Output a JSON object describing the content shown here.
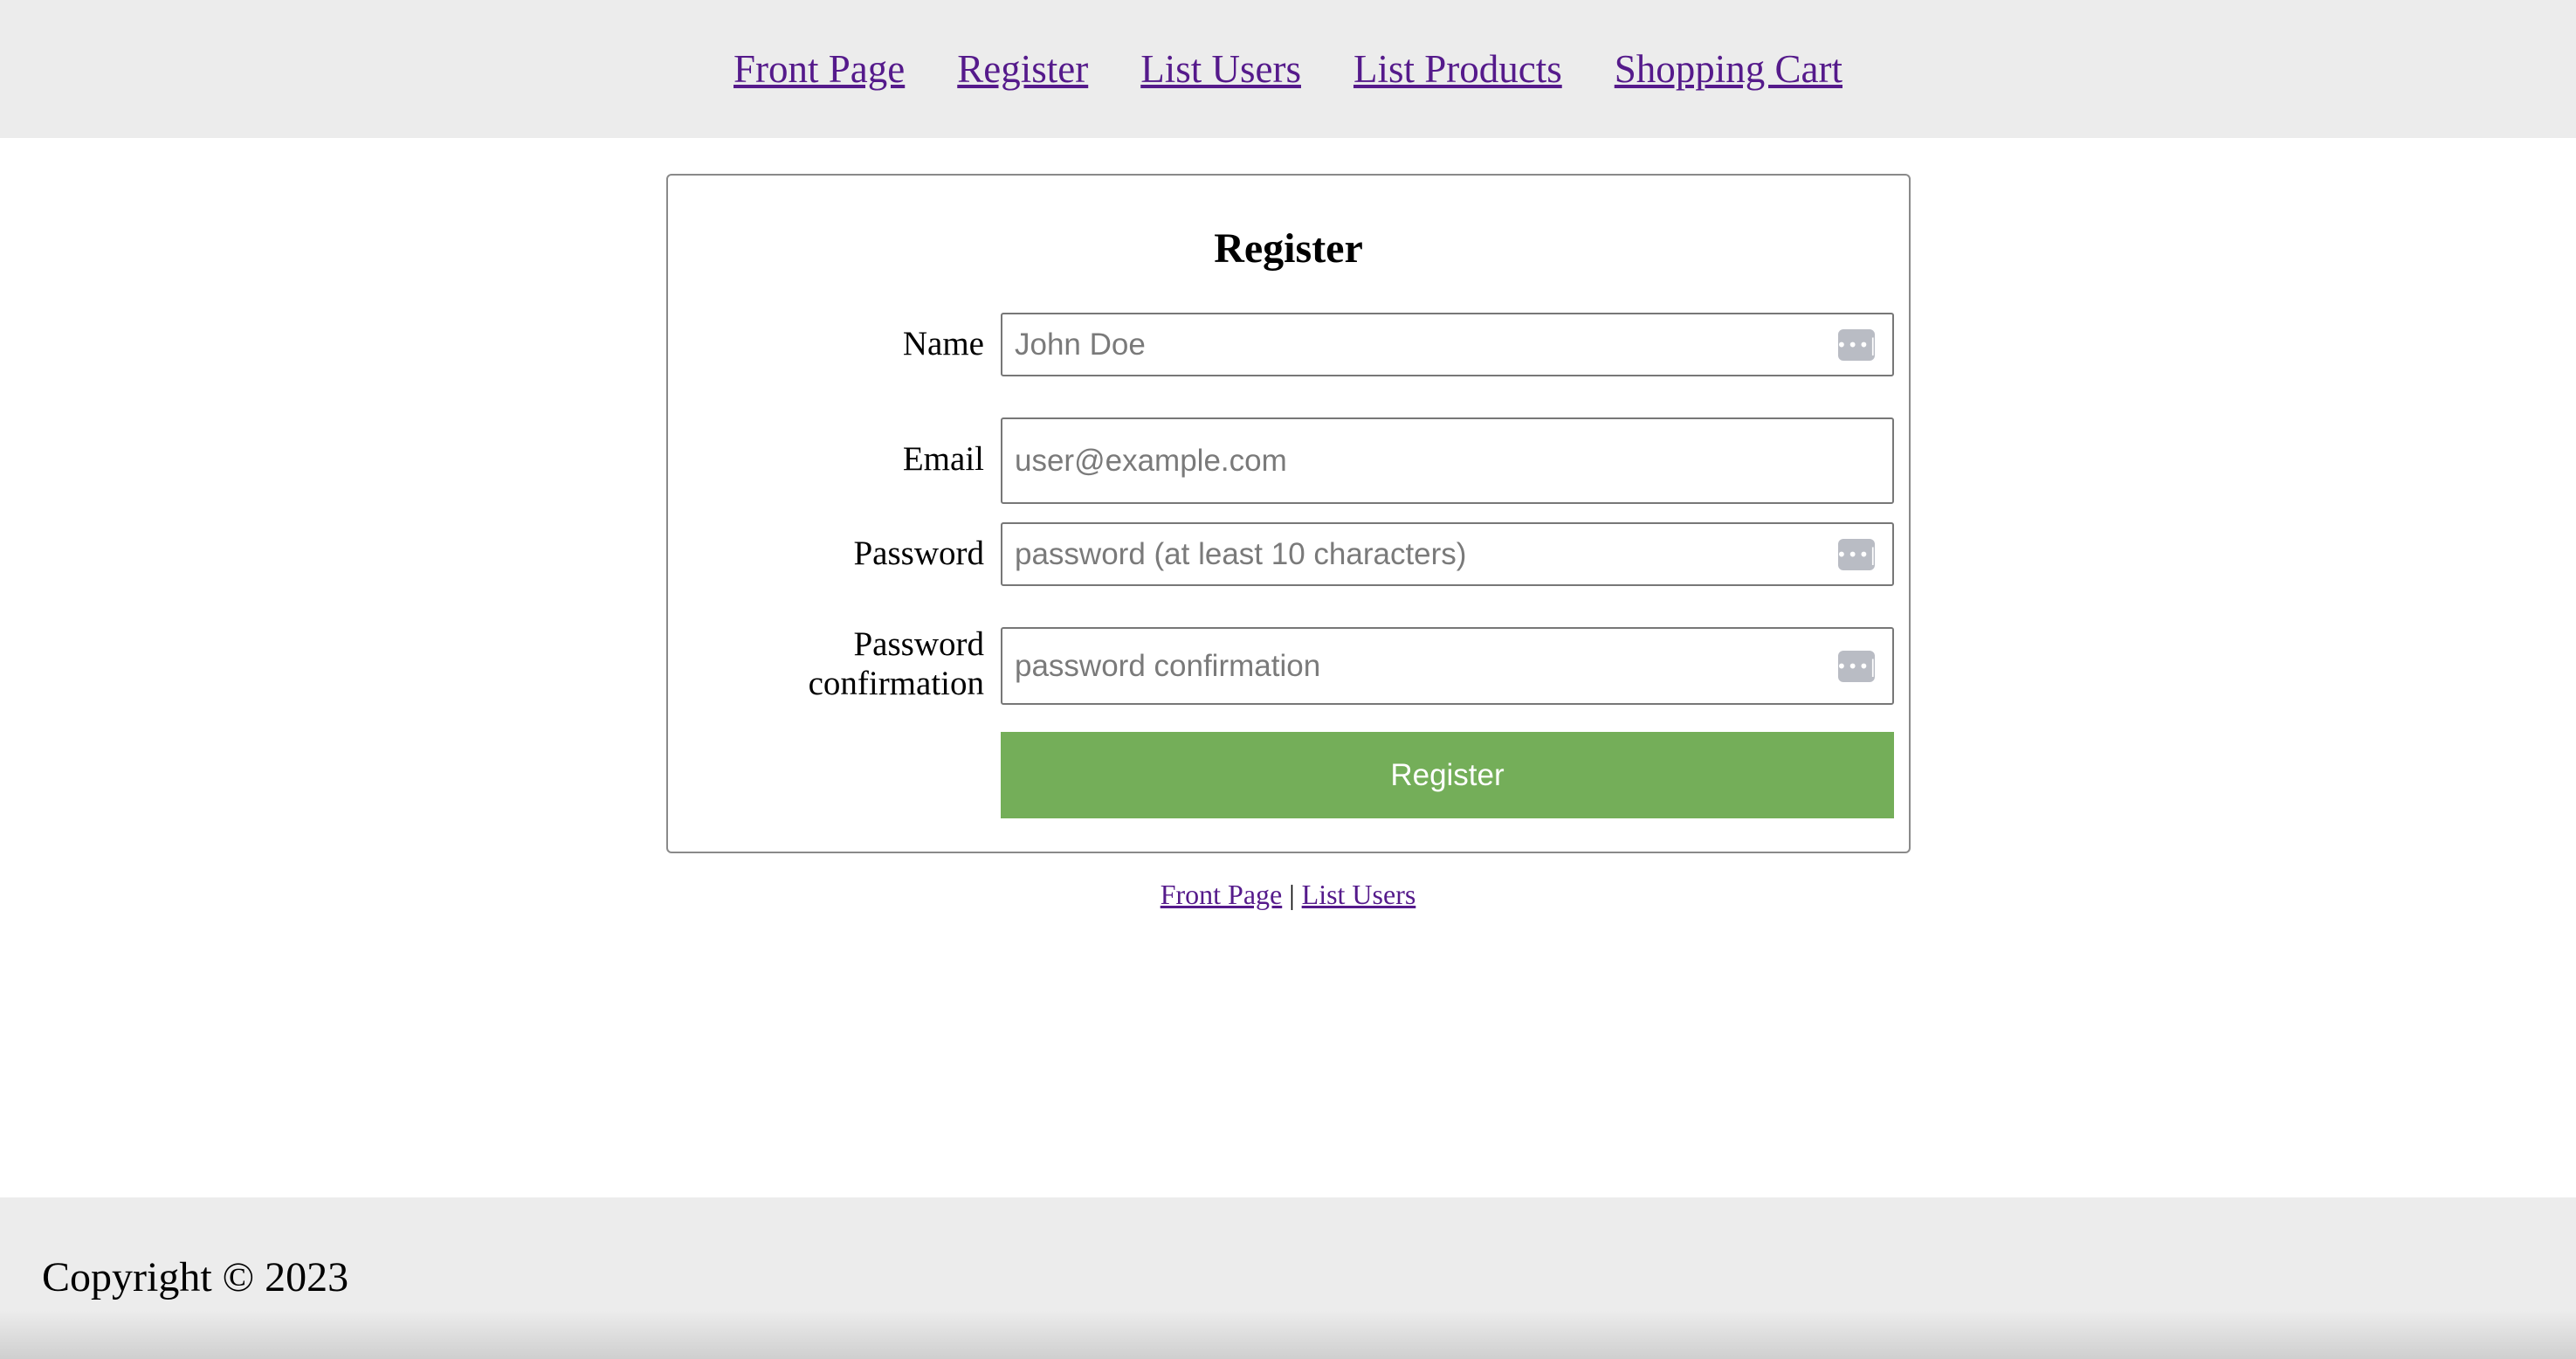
{
  "nav": {
    "items": [
      {
        "label": "Front Page"
      },
      {
        "label": "Register"
      },
      {
        "label": "List Users"
      },
      {
        "label": "List Products"
      },
      {
        "label": "Shopping Cart"
      }
    ]
  },
  "form": {
    "title": "Register",
    "name": {
      "label": "Name",
      "placeholder": "John Doe",
      "value": ""
    },
    "email": {
      "label": "Email",
      "placeholder": "user@example.com",
      "value": ""
    },
    "password": {
      "label": "Password",
      "placeholder": "password (at least 10 characters)",
      "value": ""
    },
    "password_confirmation": {
      "label_line1": "Password",
      "label_line2": "confirmation",
      "placeholder": "password confirmation",
      "value": ""
    },
    "submit_label": "Register",
    "password_manager_icon": "password-manager-icon",
    "password_manager_glyph": "•••|"
  },
  "below_links": {
    "front_page": "Front Page",
    "separator": "|",
    "list_users": "List Users"
  },
  "footer": {
    "copyright": "Copyright © 2023"
  },
  "colors": {
    "nav_bg": "#ececec",
    "link": "#551a8b",
    "button_bg": "#74ae59",
    "button_text": "#ffffff"
  }
}
